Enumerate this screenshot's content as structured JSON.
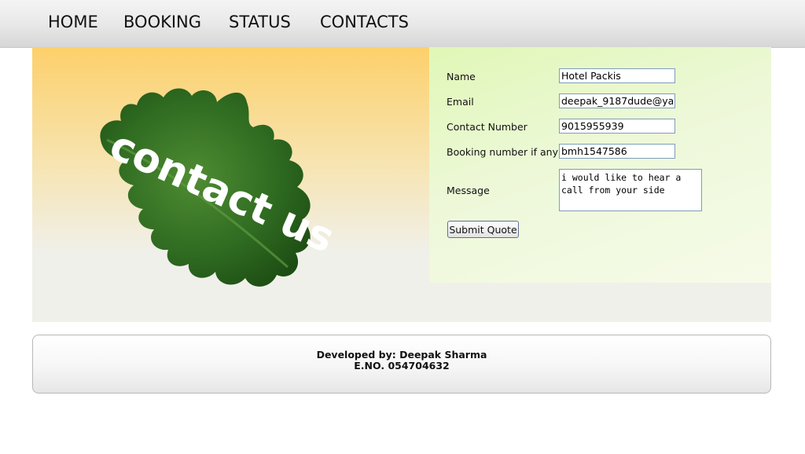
{
  "nav": {
    "items": [
      "HOME",
      "BOOKING",
      "STATUS",
      "CONTACTS"
    ]
  },
  "banner": {
    "text": "contact us",
    "leaf_color": "#2f6b21",
    "text_color": "#ffffff"
  },
  "form": {
    "name_label": "Name",
    "name_value": "Hotel Packis",
    "email_label": "Email",
    "email_value": "deepak_9187dude@ya",
    "contact_label": "Contact Number",
    "contact_value": "9015955939",
    "booking_label": "Booking number if any",
    "booking_value": "bmh1547586",
    "message_label": "Message",
    "message_value": "i would like to hear a call from your side",
    "submit_label": "Submit Quote"
  },
  "footer": {
    "developer": "Developed by: Deepak Sharma",
    "eno": "E.NO. 054704632"
  },
  "colors": {
    "form_panel": "#e0f7b6",
    "banner_top": "#fcd06b",
    "content_bg": "#f0f0ea"
  }
}
